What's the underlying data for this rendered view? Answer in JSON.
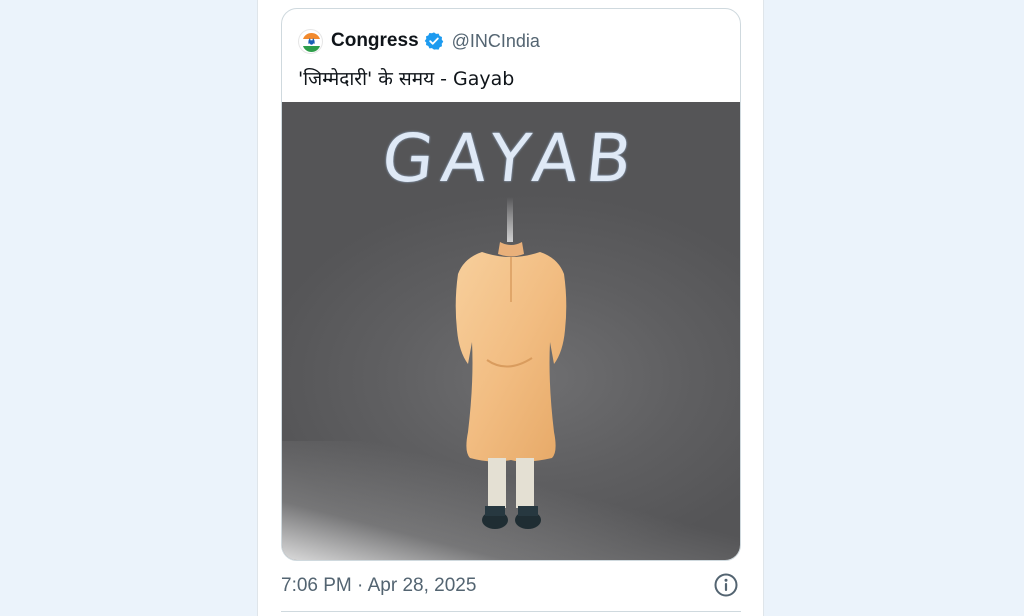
{
  "quoted_tweet": {
    "display_name": "Congress",
    "handle": "@INCIndia",
    "text": "'जिम्मेदारी' के समय - Gayab",
    "media": {
      "caption": "GAYAB"
    }
  },
  "tweet_meta": {
    "timestamp": "7:06 PM · Apr 28, 2025"
  },
  "colors": {
    "page_bg": "#ebf3fb",
    "verified_blue": "#1d9bf0",
    "muted_text": "#536471"
  },
  "icons": [
    "congress-logo-icon",
    "verified-badge-icon",
    "info-icon"
  ]
}
